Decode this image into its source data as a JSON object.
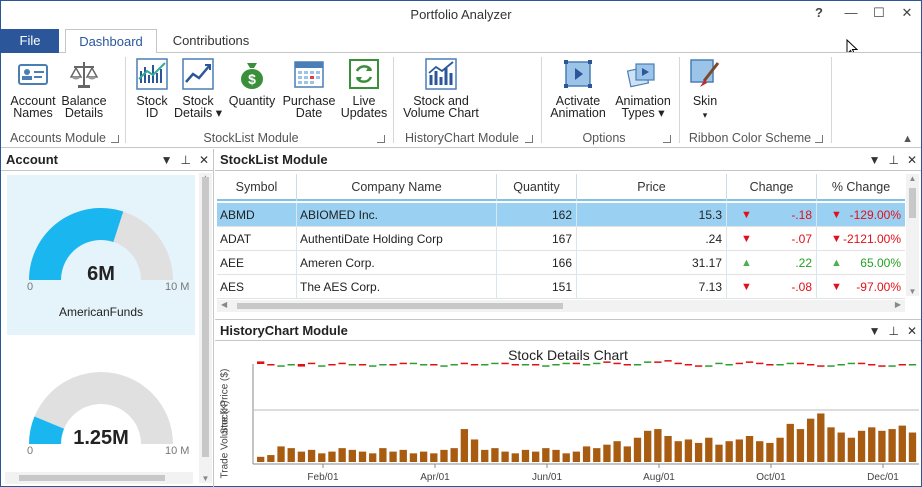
{
  "app": {
    "title": "Portfolio Analyzer",
    "help": "?",
    "minimize": "—",
    "maximize": "☐",
    "close": "✕"
  },
  "tabs": {
    "file": "File",
    "dashboard": "Dashboard",
    "contributions": "Contributions"
  },
  "ribbon": {
    "account_names": [
      "Account",
      "Names"
    ],
    "balance_details": [
      "Balance",
      "Details"
    ],
    "accounts_module": "Accounts Module",
    "stock_id": [
      "Stock",
      "ID"
    ],
    "stock_details": [
      "Stock",
      "Details ▾"
    ],
    "quantity": "Quantity",
    "purchase_date": [
      "Purchase",
      "Date"
    ],
    "live_updates": [
      "Live",
      "Updates"
    ],
    "stocklist_module": "StockList Module",
    "stock_volume": [
      "Stock and",
      "Volume Chart"
    ],
    "historychart_module": "HistoryChart Module",
    "activate_animation": [
      "Activate",
      "Animation"
    ],
    "animation_types": [
      "Animation",
      "Types ▾"
    ],
    "options": "Options",
    "skin": [
      "Skin",
      "▾"
    ],
    "ribbon_color_scheme": "Ribbon Color Scheme"
  },
  "account_panel": {
    "title": "Account",
    "gauges": [
      {
        "value": "6M",
        "min": "0",
        "max": "10 M",
        "name": "AmericanFunds",
        "fraction": 0.6
      },
      {
        "value": "1.25M",
        "min": "0",
        "max": "10 M",
        "name": "",
        "fraction": 0.125
      }
    ]
  },
  "stocklist": {
    "title": "StockList Module",
    "columns": [
      "Symbol",
      "Company Name",
      "Quantity",
      "Price",
      "Change",
      "% Change"
    ],
    "rows": [
      {
        "symbol": "ABMD",
        "company": "ABIOMED Inc.",
        "quantity": "162",
        "price": "15.3",
        "change": "-.18",
        "pct": "-129.00%",
        "dir": "down"
      },
      {
        "symbol": "ADAT",
        "company": "AuthentiDate Holding Corp",
        "quantity": "167",
        "price": ".24",
        "change": "-.07",
        "pct": "-2121.00%",
        "dir": "down"
      },
      {
        "symbol": "AEE",
        "company": "Ameren Corp.",
        "quantity": "166",
        "price": "31.17",
        "change": ".22",
        "pct": "65.00%",
        "dir": "up"
      },
      {
        "symbol": "AES",
        "company": "The AES Corp.",
        "quantity": "151",
        "price": "7.13",
        "change": "-.08",
        "pct": "-97.00%",
        "dir": "down"
      }
    ]
  },
  "history": {
    "title": "HistoryChart Module",
    "chart_title": "Stock Details Chart",
    "ylabel_price": "Stock Price ($)",
    "ylabel_volume": "Trade Volume (K)",
    "xticks": [
      "Feb/01",
      "Apr/01",
      "Jun/01",
      "Aug/01",
      "Oct/01",
      "Dec/01"
    ]
  },
  "chart_data": {
    "type": "bar",
    "title": "Stock Details Chart",
    "xlabel": "",
    "ylabel": "Trade Volume (K)",
    "categories": [
      "Feb/01",
      "Apr/01",
      "Jun/01",
      "Aug/01",
      "Oct/01",
      "Dec/01"
    ],
    "series": [
      {
        "name": "Stock Price ($)",
        "kind": "candlestick",
        "color_up": "#2e9e2e",
        "color_down": "#e01010"
      },
      {
        "name": "Trade Volume (K)",
        "color": "#a85c12",
        "values": [
          3,
          4,
          9,
          8,
          6,
          7,
          5,
          6,
          8,
          7,
          6,
          5,
          8,
          6,
          7,
          5,
          6,
          5,
          7,
          8,
          19,
          13,
          7,
          8,
          6,
          5,
          7,
          6,
          8,
          7,
          5,
          6,
          9,
          8,
          10,
          12,
          9,
          14,
          18,
          19,
          15,
          12,
          13,
          11,
          14,
          10,
          12,
          13,
          15,
          12,
          11,
          14,
          22,
          19,
          25,
          28,
          20,
          17,
          14,
          18,
          20,
          18,
          19,
          21,
          17
        ]
      },
      {
        "name": "Stock Price ($)",
        "kind": "candlestick",
        "color_up": "#2e9e2e",
        "color_down": "#e01010",
        "open": [
          62,
          60,
          58,
          59,
          60,
          61,
          58,
          60,
          61,
          59,
          60,
          58,
          59,
          60,
          61,
          60,
          59,
          60,
          58,
          59,
          61,
          60,
          59,
          60,
          61,
          60,
          59,
          60,
          58,
          59,
          60,
          61,
          59,
          60,
          62,
          61,
          60,
          59,
          61,
          62,
          63,
          61,
          60,
          59,
          58,
          60,
          59,
          61,
          62,
          61,
          60,
          59,
          60,
          61,
          60,
          59,
          58,
          59,
          60,
          61,
          60,
          59,
          58,
          60,
          59
        ],
        "close": [
          60,
          59,
          59,
          60,
          58,
          60,
          59,
          59,
          60,
          60,
          59,
          59,
          60,
          59,
          60,
          61,
          60,
          59,
          59,
          60,
          60,
          59,
          60,
          61,
          60,
          59,
          60,
          59,
          59,
          60,
          61,
          60,
          60,
          61,
          61,
          60,
          59,
          60,
          62,
          61,
          62,
          60,
          59,
          58,
          59,
          61,
          60,
          60,
          61,
          60,
          59,
          60,
          61,
          60,
          59,
          58,
          59,
          60,
          61,
          60,
          59,
          58,
          59,
          59,
          60
        ]
      }
    ]
  }
}
